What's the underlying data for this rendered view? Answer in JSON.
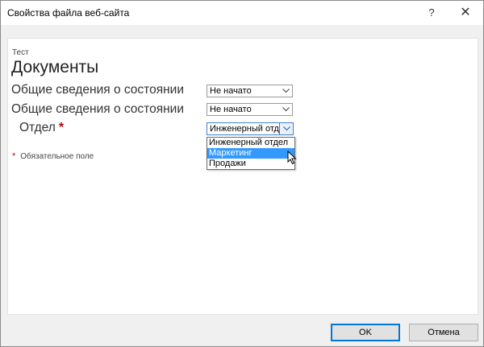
{
  "window": {
    "title": "Свойства файла веб-сайта",
    "help_label": "?",
    "close_label": "✕"
  },
  "form": {
    "content_type": "Тест",
    "heading": "Документы",
    "fields": [
      {
        "label": "Общие сведения о состоянии",
        "value": "Не начато"
      },
      {
        "label": "Общие сведения о состоянии",
        "value": "Не начато"
      },
      {
        "label": "Отдел",
        "value": "Инженерный отд",
        "required_mark": "*"
      }
    ],
    "dropdown_options": [
      "Инженерный отдел",
      "Маркетинг",
      "Продажи"
    ],
    "highlighted_option": "Маркетинг",
    "required_star": "*",
    "required_note": "Обязательное поле"
  },
  "buttons": {
    "ok": "OK",
    "cancel": "Отмена"
  },
  "icons": {
    "help": "help-icon",
    "close": "close-icon",
    "chevron": "chevron-down-icon",
    "cursor": "mouse-pointer-icon"
  },
  "colors": {
    "required": "#c00000",
    "selection": "#3399ff",
    "focus_border": "#3f7fd1",
    "primary_border": "#0078d7"
  }
}
